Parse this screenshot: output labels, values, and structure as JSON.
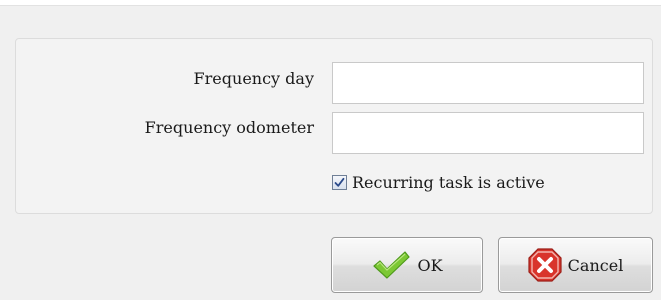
{
  "form": {
    "frequency_day": {
      "label": "Frequency day",
      "value": ""
    },
    "frequency_odometer": {
      "label": "Frequency odometer",
      "value": ""
    },
    "recurring": {
      "label": "Recurring task is active",
      "checked": true
    }
  },
  "buttons": {
    "ok": {
      "label": "OK",
      "icon": "checkmark-icon"
    },
    "cancel": {
      "label": "Cancel",
      "icon": "cancel-icon"
    }
  },
  "colors": {
    "ok_icon": "#6fbf2a",
    "cancel_icon": "#d9342b",
    "checkmark": "#2b4a8a"
  }
}
